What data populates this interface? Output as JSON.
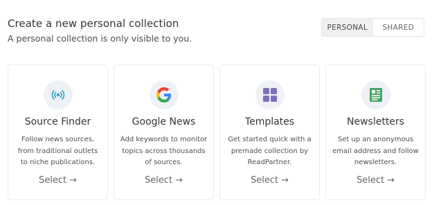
{
  "header": {
    "title": "Create a new personal collection",
    "subtitle": "A personal collection is only visible to you."
  },
  "toggle": {
    "options": [
      "PERSONAL",
      "SHARED"
    ],
    "selected": "PERSONAL"
  },
  "cards": [
    {
      "icon": "broadcast-icon",
      "title": "Source Finder",
      "desc_lines": [
        "Follow news sources,",
        "from traditional outlets",
        "to niche publications."
      ],
      "select_label": "Select",
      "arrow": "→"
    },
    {
      "icon": "google-icon",
      "title": "Google News",
      "desc_lines": [
        "Add keywords to monitor",
        "topics across thousands",
        "of sources."
      ],
      "select_label": "Select",
      "arrow": "→"
    },
    {
      "icon": "grid-icon",
      "title": "Templates",
      "desc_lines": [
        "Get started quick with a",
        "premade collection by",
        "ReadPartner."
      ],
      "select_label": "Select",
      "arrow": "→"
    },
    {
      "icon": "newsletter-icon",
      "title": "Newsletters",
      "desc_lines": [
        "Set up an anonymous",
        "email address and follow",
        "newsletters."
      ],
      "select_label": "Select",
      "arrow": "→"
    }
  ],
  "colors": {
    "broadcast": "#1fa3c9",
    "templates": "#7e6fb9",
    "newsletter": "#4aa564",
    "google_blue": "#4285f4",
    "google_red": "#ea4335",
    "google_yellow": "#fbbc05",
    "google_green": "#34a853"
  }
}
